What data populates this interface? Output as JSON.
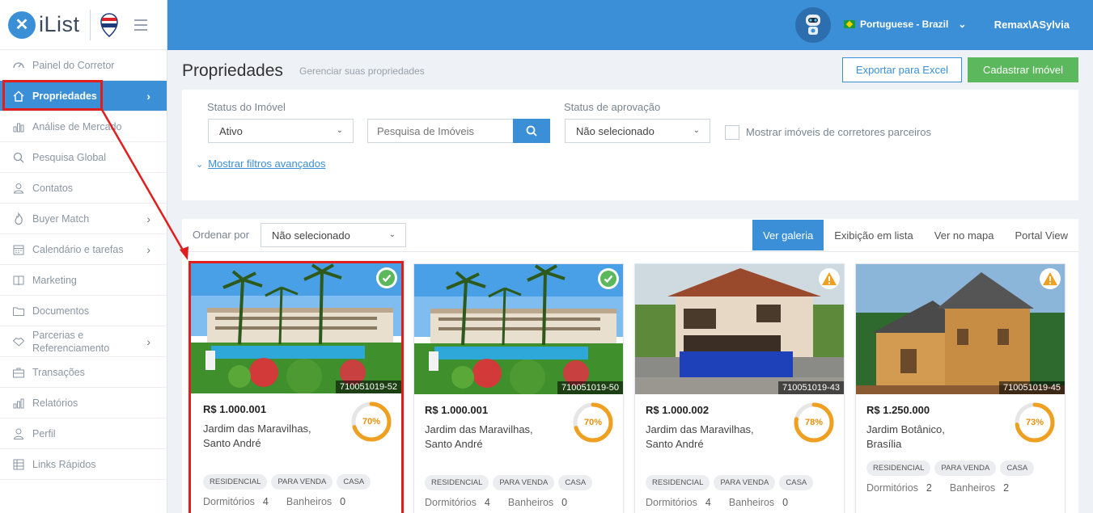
{
  "app": {
    "logo_text": "iList",
    "remax_text": "RE/MAX"
  },
  "topbar": {
    "language": "Portuguese - Brazil",
    "user": "Remax\\ASylvia"
  },
  "sidebar": {
    "items": [
      {
        "label": "Painel do Corretor",
        "icon": "dashboard-icon",
        "chevron": false
      },
      {
        "label": "Propriedades",
        "icon": "home-icon",
        "chevron": true,
        "active": true
      },
      {
        "label": "Análise de Mercado",
        "icon": "bar-chart-icon",
        "chevron": false
      },
      {
        "label": "Pesquisa Global",
        "icon": "search-icon",
        "chevron": false
      },
      {
        "label": "Contatos",
        "icon": "contacts-icon",
        "chevron": false
      },
      {
        "label": "Buyer Match",
        "icon": "fire-icon",
        "chevron": true
      },
      {
        "label": "Calendário e tarefas",
        "icon": "calendar-icon",
        "chevron": true
      },
      {
        "label": "Marketing",
        "icon": "book-icon",
        "chevron": false
      },
      {
        "label": "Documentos",
        "icon": "folder-icon",
        "chevron": false
      },
      {
        "label": "Parcerias e Referenciamento",
        "icon": "handshake-icon",
        "chevron": true
      },
      {
        "label": "Transações",
        "icon": "briefcase-icon",
        "chevron": false
      },
      {
        "label": "Relatórios",
        "icon": "report-icon",
        "chevron": false
      },
      {
        "label": "Perfil",
        "icon": "user-icon",
        "chevron": false
      },
      {
        "label": "Links Rápidos",
        "icon": "links-icon",
        "chevron": false
      }
    ]
  },
  "page": {
    "title": "Propriedades",
    "subtitle": "Gerenciar suas propriedades",
    "export_label": "Exportar para Excel",
    "add_label": "Cadastrar Imóvel"
  },
  "filters": {
    "status_label": "Status do Imóvel",
    "status_value": "Ativo",
    "search_placeholder": "Pesquisa de Imóveis",
    "approval_label": "Status de aprovação",
    "approval_value": "Não selecionado",
    "partners_label": "Mostrar imóveis de corretores parceiros",
    "advanced_link": "Mostrar filtros avançados"
  },
  "gallery": {
    "sort_label": "Ordenar por",
    "sort_value": "Não selecionado",
    "views": [
      "Ver galeria",
      "Exibição em lista",
      "Ver no mapa",
      "Portal View"
    ],
    "active_view": 0
  },
  "cards": [
    {
      "code": "710051019-52",
      "price": "R$ 1.000.001",
      "address": "Jardim das Maravilhas, Santo André",
      "score": "70%",
      "score_value": 0.7,
      "status": "approved",
      "tags": [
        "RESIDENCIAL",
        "PARA VENDA",
        "CASA"
      ],
      "bedrooms_label": "Dormitórios",
      "bedrooms": "4",
      "bathrooms_label": "Banheiros",
      "bathrooms": "0"
    },
    {
      "code": "710051019-50",
      "price": "R$ 1.000.001",
      "address": "Jardim das Maravilhas, Santo André",
      "score": "70%",
      "score_value": 0.7,
      "status": "approved",
      "tags": [
        "RESIDENCIAL",
        "PARA VENDA",
        "CASA"
      ],
      "bedrooms_label": "Dormitórios",
      "bedrooms": "4",
      "bathrooms_label": "Banheiros",
      "bathrooms": "0"
    },
    {
      "code": "710051019-43",
      "price": "R$ 1.000.002",
      "address": "Jardim das Maravilhas, Santo André",
      "score": "78%",
      "score_value": 0.78,
      "status": "warning",
      "tags": [
        "RESIDENCIAL",
        "PARA VENDA",
        "CASA"
      ],
      "bedrooms_label": "Dormitórios",
      "bedrooms": "4",
      "bathrooms_label": "Banheiros",
      "bathrooms": "0"
    },
    {
      "code": "710051019-45",
      "price": "R$ 1.250.000",
      "address": "Jardim Botânico, Brasília",
      "score": "73%",
      "score_value": 0.73,
      "status": "warning",
      "tags": [
        "RESIDENCIAL",
        "PARA VENDA",
        "CASA"
      ],
      "bedrooms_label": "Dormitórios",
      "bedrooms": "2",
      "bathrooms_label": "Banheiros",
      "bathrooms": "2"
    }
  ],
  "colors": {
    "primary": "#3b8fd6",
    "success": "#5cb85c",
    "warning": "#f0a020",
    "highlight": "#e01e1e"
  }
}
